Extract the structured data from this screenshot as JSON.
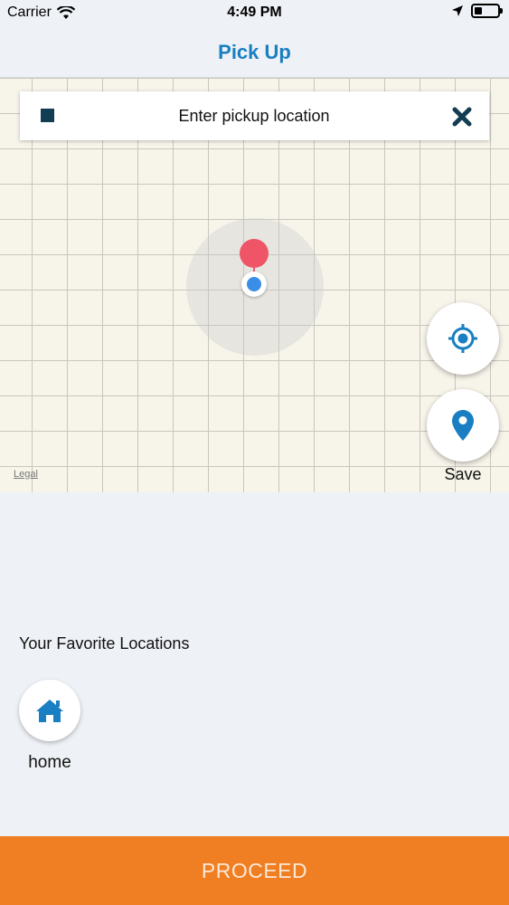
{
  "status_bar": {
    "carrier": "Carrier",
    "time": "4:49 PM",
    "icons": [
      "wifi-icon",
      "location-arrow-icon",
      "battery-icon"
    ]
  },
  "nav": {
    "title": "Pick Up"
  },
  "search": {
    "placeholder": "Enter pickup location",
    "value": ""
  },
  "map": {
    "legal_label": "Legal",
    "pin_color": "#ef5566",
    "user_dot_color": "#3a8ee6"
  },
  "controls": {
    "locate_icon": "crosshair-icon",
    "save_icon": "map-pin-icon",
    "save_label": "Save"
  },
  "favorites": {
    "heading": "Your Favorite Locations",
    "items": [
      {
        "label": "home",
        "icon": "home-icon"
      }
    ]
  },
  "actions": {
    "proceed_label": "PROCEED"
  },
  "colors": {
    "accent": "#1a7fc2",
    "proceed_bg": "#ef7f22",
    "icon_dark": "#123d52"
  }
}
